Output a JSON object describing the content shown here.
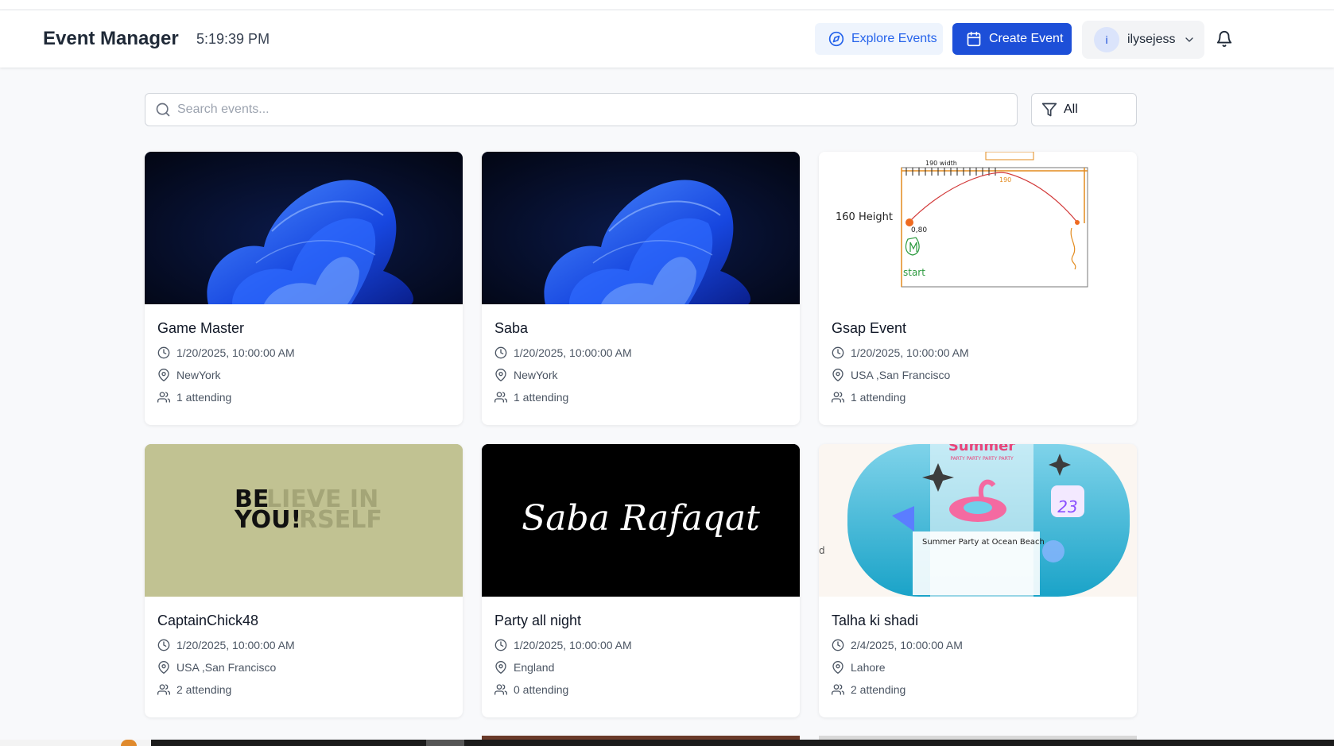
{
  "header": {
    "title": "Event Manager",
    "time": "5:19:39 PM",
    "explore_label": "Explore Events",
    "create_label": "Create Event",
    "avatar_initial": "i",
    "username": "ilysejess"
  },
  "search": {
    "placeholder": "Search events...",
    "value": ""
  },
  "filter": {
    "label": "All"
  },
  "events": [
    {
      "title": "Game Master",
      "datetime": "1/20/2025, 10:00:00 AM",
      "location": "NewYork",
      "attending": "1 attending"
    },
    {
      "title": "Saba",
      "datetime": "1/20/2025, 10:00:00 AM",
      "location": "NewYork",
      "attending": "1 attending"
    },
    {
      "title": "Gsap Event",
      "datetime": "1/20/2025, 10:00:00 AM",
      "location": "USA ,San Francisco",
      "attending": "1 attending"
    },
    {
      "title": "CaptainChick48",
      "datetime": "1/20/2025, 10:00:00 AM",
      "location": "USA ,San Francisco",
      "attending": "2 attending"
    },
    {
      "title": "Party all night",
      "datetime": "1/20/2025, 10:00:00 AM",
      "location": "England",
      "attending": "0 attending"
    },
    {
      "title": "Talha ki shadi",
      "datetime": "2/4/2025, 10:00:00 AM",
      "location": "Lahore",
      "attending": "2 attending"
    }
  ],
  "images": {
    "sketch": {
      "width_label": "190 width",
      "height_label": "160 Height",
      "point_label": "0,80",
      "start_label": "start",
      "top_label": "190"
    },
    "believe": {
      "line1_bold": "BE",
      "line1_faded": "LIEVE IN",
      "line2_bold": "YOU!",
      "line2_faded": "RSELF"
    },
    "signature": {
      "text": "Saba Rafaqat"
    },
    "summer": {
      "headline": "Summer",
      "subline": "PARTY PARTY PARTY PARTY",
      "title": "Summer Party at Ocean Beach",
      "date_num": "23",
      "side_text": "d"
    }
  },
  "colors": {
    "accent": "#1d4fd8",
    "accent_soft": "#eef4fd",
    "olive": "#c1c292",
    "dark_navy": "#04091c"
  }
}
